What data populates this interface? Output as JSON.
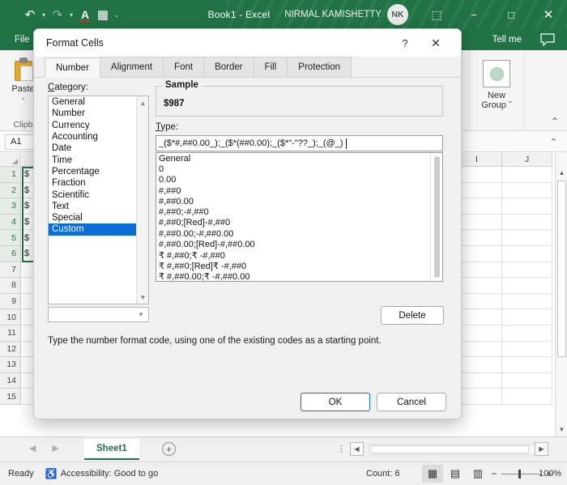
{
  "titlebar": {
    "quick_access": [
      {
        "name": "undo",
        "glyph": "↶"
      },
      {
        "name": "redo",
        "glyph": "↷"
      },
      {
        "name": "font-color",
        "glyph": "A"
      },
      {
        "name": "borders",
        "glyph": "▦"
      },
      {
        "name": "customize-quick-access-toolbar",
        "glyph": "⌄"
      }
    ],
    "document_title": "Book1  -  Excel",
    "account_name": "NIRMAL KAMISHETTY",
    "account_initials": "NK",
    "ribbon_display_glyph": "⬚",
    "minimize_glyph": "−",
    "maximize_glyph": "□",
    "close_glyph": "✕"
  },
  "ribbon": {
    "file_tab": "File",
    "tell_me": "Tell me",
    "comment_glyph": "▭",
    "paste": {
      "label": "Paste",
      "caret": "⌄"
    },
    "clipboard_group_label": "Clipb",
    "new_group": {
      "line1": "New",
      "line2": "Group",
      "caret": "ˇ"
    },
    "collapse_glyph": "⌃"
  },
  "formula_bar": {
    "name_box_value": "A1",
    "expand_glyph": "⌃"
  },
  "grid": {
    "column_headers": [
      "I",
      "J"
    ],
    "row_headers": [
      "1",
      "2",
      "3",
      "4",
      "5",
      "6",
      "7",
      "8",
      "9",
      "10",
      "11",
      "12",
      "13",
      "14",
      "15"
    ],
    "selected_rows": [
      "1",
      "2",
      "3",
      "4",
      "5",
      "6"
    ],
    "column_a_values": [
      "$",
      "$",
      "$",
      "$",
      "$",
      "$"
    ],
    "scroll_up_glyph": "▲",
    "scroll_down_glyph": "▼"
  },
  "sheet_tabs": {
    "prev_glyph": "◀",
    "next_glyph": "▶",
    "sheets": [
      "Sheet1"
    ],
    "active_sheet": "Sheet1",
    "add_sheet_glyph": "+",
    "more_glyph": "⋮",
    "hscroll_left_glyph": "◀",
    "hscroll_right_glyph": "▶"
  },
  "status_bar": {
    "state": "Ready",
    "accessibility": "Accessibility: Good to go",
    "accessibility_icon": "♿",
    "count": "Count: 6",
    "views": [
      {
        "name": "normal-view",
        "glyph": "▦",
        "active": true
      },
      {
        "name": "page-layout-view",
        "glyph": "▤",
        "active": false
      },
      {
        "name": "page-break-preview",
        "glyph": "▥",
        "active": false
      }
    ],
    "zoom_out_glyph": "−",
    "zoom_in_glyph": "+",
    "zoom_level": "100%"
  },
  "dialog": {
    "title": "Format Cells",
    "help_glyph": "?",
    "close_glyph": "✕",
    "tabs": [
      {
        "label": "Number",
        "active": true
      },
      {
        "label": "Alignment",
        "active": false
      },
      {
        "label": "Font",
        "active": false
      },
      {
        "label": "Border",
        "active": false
      },
      {
        "label": "Fill",
        "active": false
      },
      {
        "label": "Protection",
        "active": false
      }
    ],
    "category_label": "Category:",
    "categories": [
      "General",
      "Number",
      "Currency",
      "Accounting",
      "Date",
      "Time",
      "Percentage",
      "Fraction",
      "Scientific",
      "Text",
      "Special",
      "Custom"
    ],
    "selected_category": "Custom",
    "sample_label": "Sample",
    "sample_value": "$987",
    "type_label": "Type:",
    "type_value": "_($*#,##0.00_);_($*(##0.00);_($*\"-\"??_);_(@_)",
    "type_list": [
      "General",
      "0",
      "0.00",
      "#,##0",
      "#,##0.00",
      "#,##0;-#,##0",
      "#,##0;[Red]-#,##0",
      "#,##0.00;-#,##0.00",
      "#,##0.00;[Red]-#,##0.00",
      "₹ #,##0;₹ -#,##0",
      "₹ #,##0;[Red]₹ -#,##0",
      "₹ #,##0.00;₹ -#,##0.00"
    ],
    "combo_arrow_glyph": "▼",
    "delete_label": "Delete",
    "hint_text": "Type the number format code, using one of the existing codes as a starting point.",
    "ok_label": "OK",
    "cancel_label": "Cancel"
  },
  "colors": {
    "excel_green": "#217346",
    "selection_blue": "#0a6cd4",
    "accent_border": "#217346"
  }
}
